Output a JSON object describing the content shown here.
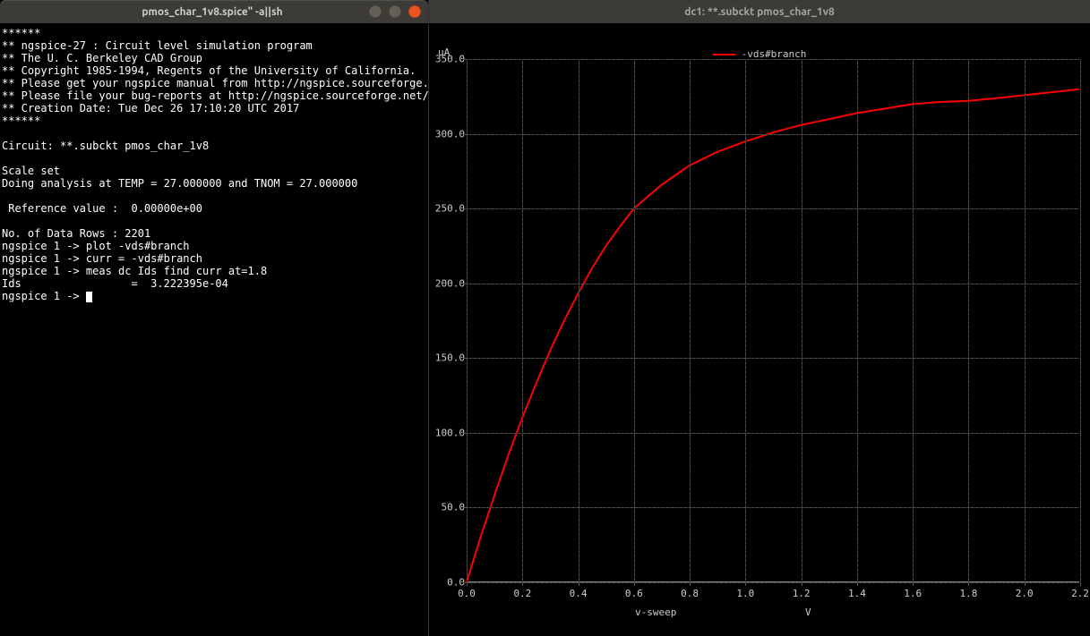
{
  "terminal": {
    "title": "pmos_char_1v8.spice\" -a||sh",
    "lines": [
      "******",
      "** ngspice-27 : Circuit level simulation program",
      "** The U. C. Berkeley CAD Group",
      "** Copyright 1985-1994, Regents of the University of California.",
      "** Please get your ngspice manual from http://ngspice.sourceforge.net/docs.html",
      "** Please file your bug-reports at http://ngspice.sourceforge.net/bugrep.html",
      "** Creation Date: Tue Dec 26 17:10:20 UTC 2017",
      "******",
      "",
      "Circuit: **.subckt pmos_char_1v8",
      "",
      "Scale set",
      "Doing analysis at TEMP = 27.000000 and TNOM = 27.000000",
      "",
      " Reference value :  0.00000e+00",
      "",
      "No. of Data Rows : 2201",
      "ngspice 1 -> plot -vds#branch",
      "ngspice 1 -> curr = -vds#branch",
      "ngspice 1 -> meas dc Ids find curr at=1.8",
      "Ids                 =  3.222395e-04",
      "ngspice 1 -> "
    ]
  },
  "plot": {
    "title": "dc1: **.subckt pmos_char_1v8",
    "y_unit": "uA",
    "legend": "-vds#branch",
    "xlabel_left": "v-sweep",
    "xlabel_right": "V"
  },
  "chart_data": {
    "type": "line",
    "title": "dc1: **.subckt pmos_char_1v8",
    "xlabel": "v-sweep (V)",
    "ylabel": "uA",
    "xlim": [
      0.0,
      2.2
    ],
    "ylim": [
      0.0,
      350.0
    ],
    "xticks": [
      0.0,
      0.2,
      0.4,
      0.6,
      0.8,
      1.0,
      1.2,
      1.4,
      1.6,
      1.8,
      2.0,
      2.2
    ],
    "yticks": [
      0.0,
      50.0,
      100.0,
      150.0,
      200.0,
      250.0,
      300.0,
      350.0
    ],
    "series": [
      {
        "name": "-vds#branch",
        "color": "#ff0000",
        "x": [
          0.0,
          0.05,
          0.1,
          0.15,
          0.2,
          0.25,
          0.3,
          0.35,
          0.4,
          0.45,
          0.5,
          0.55,
          0.6,
          0.7,
          0.8,
          0.9,
          1.0,
          1.1,
          1.2,
          1.3,
          1.4,
          1.5,
          1.6,
          1.7,
          1.8,
          1.9,
          2.0,
          2.1,
          2.2
        ],
        "values": [
          0,
          30,
          58,
          85,
          110,
          133,
          155,
          175,
          193,
          210,
          225,
          238,
          250,
          266,
          279,
          288,
          295,
          301,
          306,
          310,
          314,
          317,
          320,
          321.5,
          322.24,
          324,
          326,
          328,
          330
        ]
      }
    ]
  }
}
